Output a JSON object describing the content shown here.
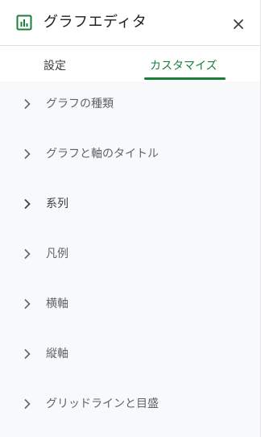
{
  "header": {
    "title": "グラフエディタ",
    "icon": "bar-chart-icon",
    "close_icon": "close-icon"
  },
  "tabs": [
    {
      "label": "設定",
      "active": false
    },
    {
      "label": "カスタマイズ",
      "active": true
    }
  ],
  "sections": [
    {
      "label": "グラフの種類"
    },
    {
      "label": "グラフと軸のタイトル"
    },
    {
      "label": "系列"
    },
    {
      "label": "凡例"
    },
    {
      "label": "横軸"
    },
    {
      "label": "縦軸"
    },
    {
      "label": "グリッドラインと目盛"
    }
  ],
  "colors": {
    "accent": "#188038",
    "section_bg": "#f8f9fa",
    "text_muted": "#5f6368"
  }
}
